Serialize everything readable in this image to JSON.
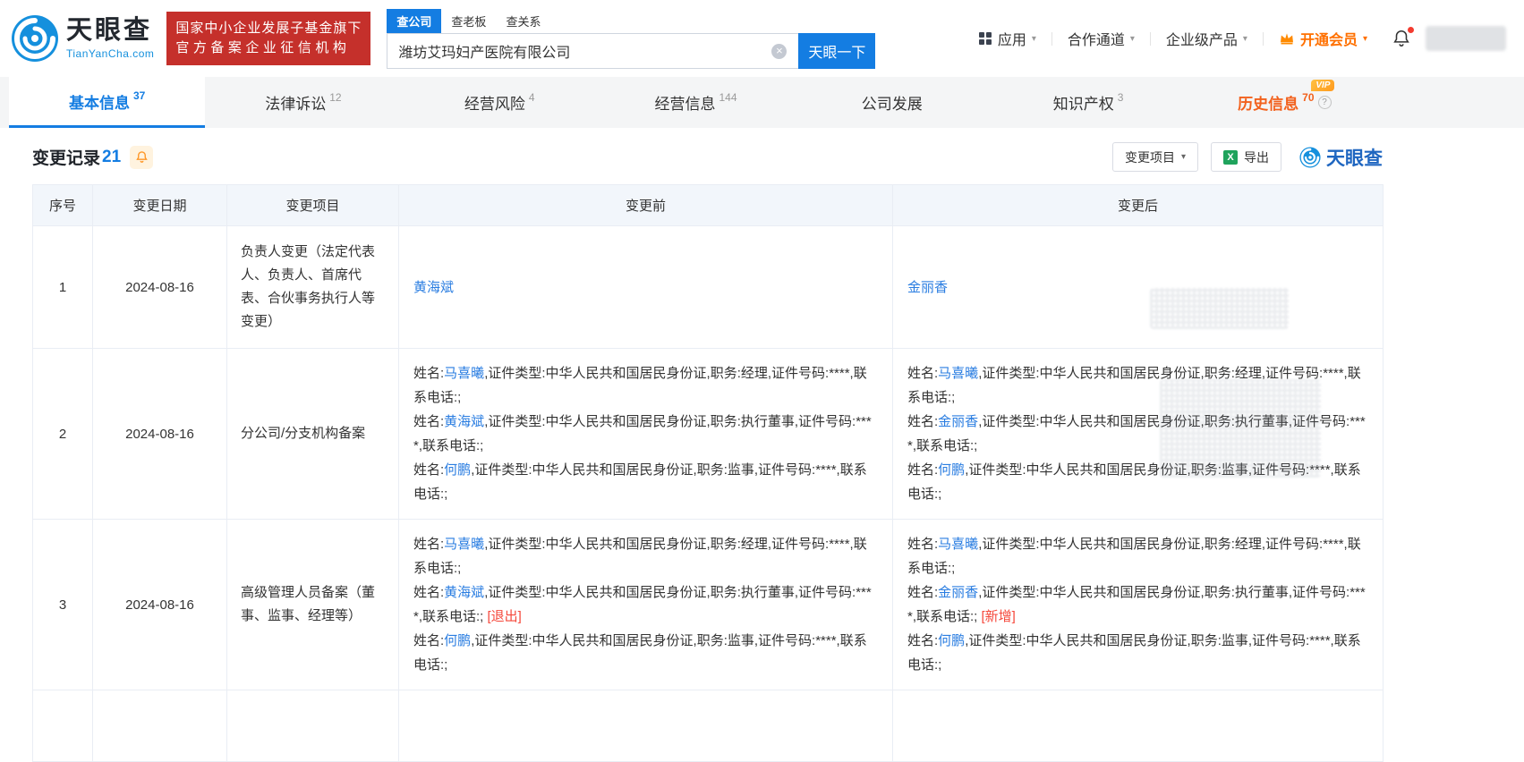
{
  "header": {
    "logo": {
      "name": "天眼查",
      "domain": "TianYanCha.com"
    },
    "badge": {
      "line1": "国家中小企业发展子基金旗下",
      "line2": "官方备案企业征信机构"
    },
    "search": {
      "tabs": [
        {
          "label": "查公司",
          "active": true
        },
        {
          "label": "查老板",
          "active": false
        },
        {
          "label": "查关系",
          "active": false
        }
      ],
      "value": "潍坊艾玛妇产医院有限公司",
      "submit_label": "天眼一下"
    },
    "nav": {
      "apps": "应用",
      "cooperation": "合作通道",
      "enterprise": "企业级产品",
      "vip": "开通会员"
    }
  },
  "tabbar": {
    "tabs": [
      {
        "label": "基本信息",
        "count": "37",
        "active": true
      },
      {
        "label": "法律诉讼",
        "count": "12",
        "active": false
      },
      {
        "label": "经营风险",
        "count": "4",
        "active": false
      },
      {
        "label": "经营信息",
        "count": "144",
        "active": false
      },
      {
        "label": "公司发展",
        "count": "",
        "active": false
      },
      {
        "label": "知识产权",
        "count": "3",
        "active": false
      },
      {
        "label": "历史信息",
        "count": "70",
        "active": false,
        "vip": "VIP"
      }
    ]
  },
  "section": {
    "title": "变更记录",
    "count": "21",
    "filter_label": "变更项目",
    "export_label": "导出",
    "brand": "天眼查"
  },
  "table": {
    "headers": {
      "no": "序号",
      "date": "变更日期",
      "item": "变更项目",
      "before": "变更前",
      "after": "变更后"
    },
    "rows": [
      {
        "no": "1",
        "date": "2024-08-16",
        "item": "负责人变更（法定代表人、负责人、首席代表、合伙事务执行人等变更）",
        "before": [
          [
            {
              "t": "link",
              "s": "黄海斌"
            }
          ]
        ],
        "after": [
          [
            {
              "t": "link",
              "s": "金丽香"
            }
          ]
        ]
      },
      {
        "no": "2",
        "date": "2024-08-16",
        "item": "分公司/分支机构备案",
        "before": [
          [
            {
              "t": "text",
              "s": "姓名:"
            },
            {
              "t": "link",
              "s": "马喜曦"
            },
            {
              "t": "text",
              "s": ",证件类型:中华人民共和国居民身份证,职务:经理,证件号码:****,联系电话:;"
            }
          ],
          [
            {
              "t": "text",
              "s": "姓名:"
            },
            {
              "t": "link",
              "s": "黄海斌"
            },
            {
              "t": "text",
              "s": ",证件类型:中华人民共和国居民身份证,职务:执行董事,证件号码:****,联系电话:;"
            }
          ],
          [
            {
              "t": "text",
              "s": "姓名:"
            },
            {
              "t": "link",
              "s": "何鹏"
            },
            {
              "t": "text",
              "s": ",证件类型:中华人民共和国居民身份证,职务:监事,证件号码:****,联系电话:;"
            }
          ]
        ],
        "after": [
          [
            {
              "t": "text",
              "s": "姓名:"
            },
            {
              "t": "link",
              "s": "马喜曦"
            },
            {
              "t": "text",
              "s": ",证件类型:中华人民共和国居民身份证,职务:经理,证件号码:****,联系电话:;"
            }
          ],
          [
            {
              "t": "text",
              "s": "姓名:"
            },
            {
              "t": "link",
              "s": "金丽香"
            },
            {
              "t": "text",
              "s": ",证件类型:中华人民共和国居民身份证,职务:执行董事,证件号码:****,联系电话:;"
            }
          ],
          [
            {
              "t": "text",
              "s": "姓名:"
            },
            {
              "t": "link",
              "s": "何鹏"
            },
            {
              "t": "text",
              "s": ",证件类型:中华人民共和国居民身份证,职务:监事,证件号码:****,联系电话:;"
            }
          ]
        ]
      },
      {
        "no": "3",
        "date": "2024-08-16",
        "item": "高级管理人员备案（董事、监事、经理等）",
        "before": [
          [
            {
              "t": "text",
              "s": "姓名:"
            },
            {
              "t": "link",
              "s": "马喜曦"
            },
            {
              "t": "text",
              "s": ",证件类型:中华人民共和国居民身份证,职务:经理,证件号码:****,联系电话:;"
            }
          ],
          [
            {
              "t": "text",
              "s": "姓名:"
            },
            {
              "t": "link",
              "s": "黄海斌"
            },
            {
              "t": "text",
              "s": ",证件类型:中华人民共和国居民身份证,职务:执行董事,证件号码:****,联系电话:; "
            },
            {
              "t": "tag",
              "s": "[退出]"
            }
          ],
          [
            {
              "t": "text",
              "s": "姓名:"
            },
            {
              "t": "link",
              "s": "何鹏"
            },
            {
              "t": "text",
              "s": ",证件类型:中华人民共和国居民身份证,职务:监事,证件号码:****,联系电话:;"
            }
          ]
        ],
        "after": [
          [
            {
              "t": "text",
              "s": "姓名:"
            },
            {
              "t": "link",
              "s": "马喜曦"
            },
            {
              "t": "text",
              "s": ",证件类型:中华人民共和国居民身份证,职务:经理,证件号码:****,联系电话:;"
            }
          ],
          [
            {
              "t": "text",
              "s": "姓名:"
            },
            {
              "t": "link",
              "s": "金丽香"
            },
            {
              "t": "text",
              "s": ",证件类型:中华人民共和国居民身份证,职务:执行董事,证件号码:****,联系电话:; "
            },
            {
              "t": "tag",
              "s": "[新增]"
            }
          ],
          [
            {
              "t": "text",
              "s": "姓名:"
            },
            {
              "t": "link",
              "s": "何鹏"
            },
            {
              "t": "text",
              "s": ",证件类型:中华人民共和国居民身份证,职务:监事,证件号码:****,联系电话:;"
            }
          ]
        ]
      }
    ]
  }
}
